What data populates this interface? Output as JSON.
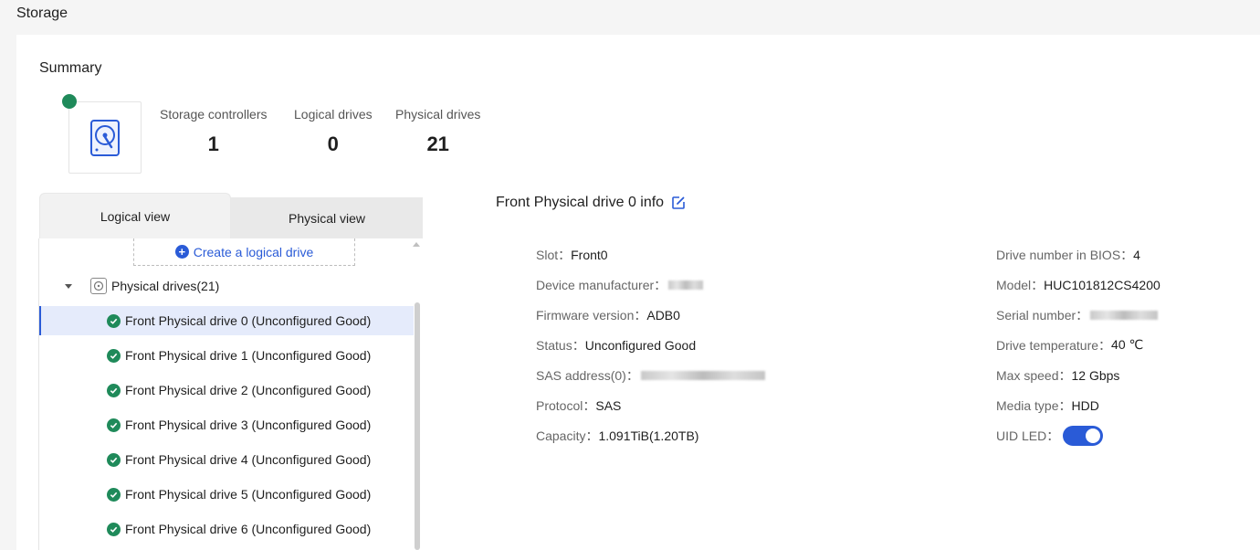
{
  "page": {
    "title": "Storage"
  },
  "summary": {
    "title": "Summary",
    "stats": [
      {
        "label": "Storage controllers",
        "value": "1"
      },
      {
        "label": "Logical drives",
        "value": "0"
      },
      {
        "label": "Physical drives",
        "value": "21"
      }
    ],
    "status_color": "#1f8a5a"
  },
  "tabs": [
    {
      "label": "Logical view",
      "active": true
    },
    {
      "label": "Physical view",
      "active": false
    }
  ],
  "tree": {
    "create_label": "Create a logical drive",
    "group_label": "Physical drives(21)",
    "items": [
      "Front Physical drive 0 (Unconfigured Good)",
      "Front Physical drive 1 (Unconfigured Good)",
      "Front Physical drive 2 (Unconfigured Good)",
      "Front Physical drive 3 (Unconfigured Good)",
      "Front Physical drive 4 (Unconfigured Good)",
      "Front Physical drive 5 (Unconfigured Good)",
      "Front Physical drive 6 (Unconfigured Good)"
    ],
    "selected_index": 0
  },
  "info": {
    "title": "Front Physical drive 0 info",
    "left": [
      {
        "label": "Slot：",
        "value": "Front0"
      },
      {
        "label": "Device manufacturer：",
        "value": ""
      },
      {
        "label": "Firmware version：",
        "value": "ADB0"
      },
      {
        "label": "Status：",
        "value": "Unconfigured Good"
      },
      {
        "label": "SAS address(0)：",
        "value": ""
      },
      {
        "label": "Protocol：",
        "value": "SAS"
      },
      {
        "label": "Capacity：",
        "value": "1.091TiB(1.20TB)"
      }
    ],
    "right": [
      {
        "label": "Drive number in BIOS：",
        "value": "4"
      },
      {
        "label": "Model：",
        "value": "HUC101812CS4200"
      },
      {
        "label": "Serial number：",
        "value": ""
      },
      {
        "label": "Drive temperature：",
        "value": "40 ℃"
      },
      {
        "label": "Max speed：",
        "value": "12 Gbps"
      },
      {
        "label": "Media type：",
        "value": "HDD"
      },
      {
        "label": "UID LED：",
        "value": ""
      }
    ],
    "uid_led_on": true,
    "accent": "#2a5bd7"
  }
}
